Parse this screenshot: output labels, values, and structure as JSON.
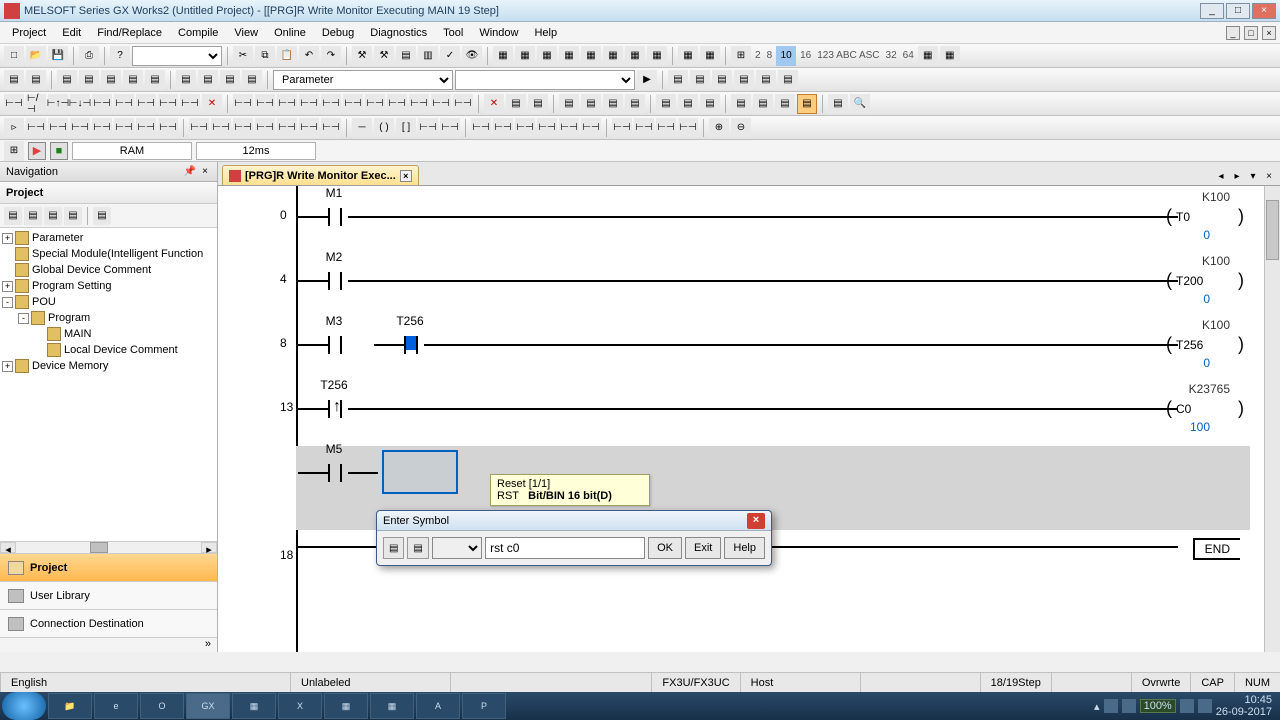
{
  "window": {
    "title": "MELSOFT Series GX Works2 (Untitled Project) - [[PRG]R Write Monitor Executing MAIN 19 Step]"
  },
  "menu": {
    "items": [
      "Project",
      "Edit",
      "Find/Replace",
      "Compile",
      "View",
      "Online",
      "Debug",
      "Diagnostics",
      "Tool",
      "Window",
      "Help"
    ]
  },
  "toolbar2": {
    "param_label": "Parameter"
  },
  "toolbar4": {
    "nums": [
      "2",
      "8",
      "10",
      "16",
      "32",
      "64"
    ]
  },
  "status": {
    "mode": "RAM",
    "scan": "12ms"
  },
  "nav": {
    "title": "Navigation",
    "subtitle": "Project",
    "tree": [
      {
        "level": 0,
        "exp": "+",
        "label": "Parameter"
      },
      {
        "level": 0,
        "exp": "",
        "label": "Special Module(Intelligent Function"
      },
      {
        "level": 0,
        "exp": "",
        "label": "Global Device Comment"
      },
      {
        "level": 0,
        "exp": "+",
        "label": "Program Setting"
      },
      {
        "level": 0,
        "exp": "-",
        "label": "POU"
      },
      {
        "level": 1,
        "exp": "-",
        "label": "Program"
      },
      {
        "level": 2,
        "exp": "",
        "label": "MAIN"
      },
      {
        "level": 2,
        "exp": "",
        "label": "Local Device Comment"
      },
      {
        "level": 0,
        "exp": "+",
        "label": "Device Memory"
      }
    ],
    "tabs": [
      "Project",
      "User Library",
      "Connection Destination"
    ]
  },
  "tabs": {
    "active": "[PRG]R Write Monitor Exec..."
  },
  "ladder": {
    "rungs": [
      {
        "num": "0",
        "contacts": [
          {
            "label": "M1"
          }
        ],
        "k": "K100",
        "coil": "T0",
        "live": "0"
      },
      {
        "num": "4",
        "contacts": [
          {
            "label": "M2"
          }
        ],
        "k": "K100",
        "coil": "T200",
        "live": "0"
      },
      {
        "num": "8",
        "contacts": [
          {
            "label": "M3"
          },
          {
            "label": "T256",
            "edited": true
          }
        ],
        "k": "K100",
        "coil": "T256",
        "live": "0"
      },
      {
        "num": "13",
        "contacts": [
          {
            "label": "T256",
            "rising": true
          }
        ],
        "k": "K23765",
        "coil": "C0",
        "live": "100"
      },
      {
        "num": "",
        "contacts": [
          {
            "label": "M5"
          }
        ],
        "dirty": true,
        "selected": true
      },
      {
        "num": "18",
        "end": "END"
      }
    ]
  },
  "tooltip": {
    "line1": "Reset [1/1]",
    "line2a": "RST",
    "line2b": "Bit/BIN 16 bit(D)"
  },
  "dialog": {
    "title": "Enter Symbol",
    "value": "rst c0",
    "ok": "OK",
    "exit": "Exit",
    "help": "Help"
  },
  "statusbar": {
    "lang": "English",
    "unlabeled": "Unlabeled",
    "plc": "FX3U/FX3UC",
    "host": "Host",
    "step": "18/19Step",
    "ovr": "Ovrwrte",
    "cap": "CAP",
    "num": "NUM"
  },
  "taskbar": {
    "battery": "100%",
    "time": "10:45",
    "date": "26-09-2017"
  }
}
